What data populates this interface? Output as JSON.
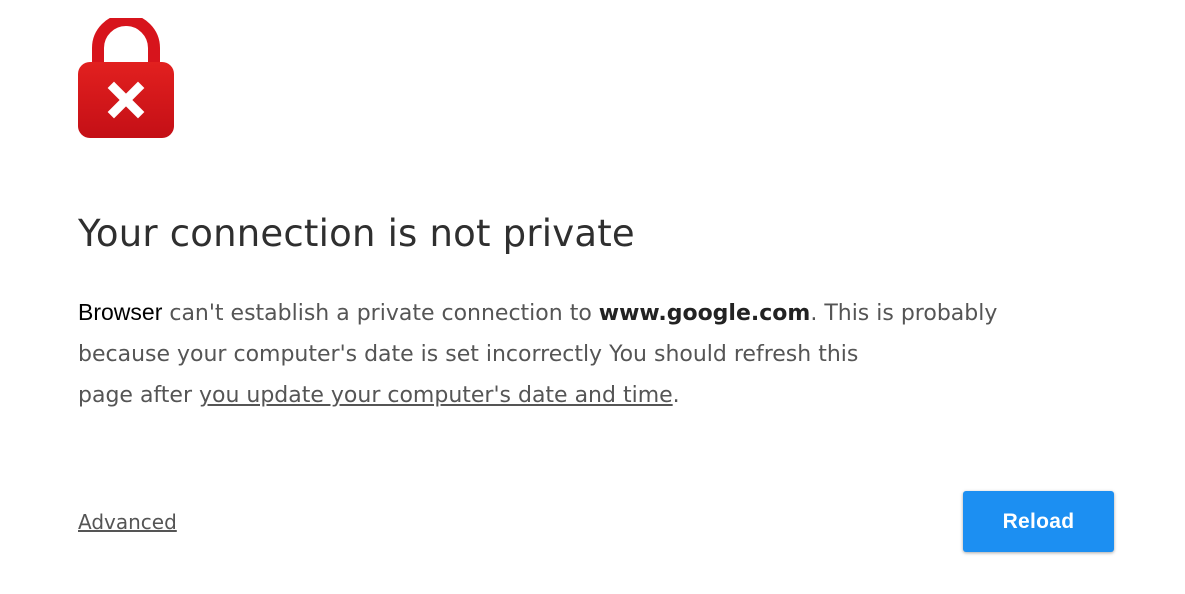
{
  "icon": {
    "name": "lock-error-icon",
    "color": "#d7141c",
    "mark": "close-icon"
  },
  "heading": "Your connection is not private",
  "message": {
    "browser_name": "Browser",
    "line1_part1": " can't establish a private connection to ",
    "domain": "www.google.com",
    "line1_part2": ". This is probably",
    "line2": "because your computer's date is set incorrectly You should refresh this",
    "line3_prefix": "page after ",
    "line3_link": "you update your computer's date and time",
    "line3_suffix": "."
  },
  "advanced_label": "Advanced",
  "reload_label": "Reload",
  "colors": {
    "accent": "#1c8ff2",
    "error": "#d7141c"
  }
}
